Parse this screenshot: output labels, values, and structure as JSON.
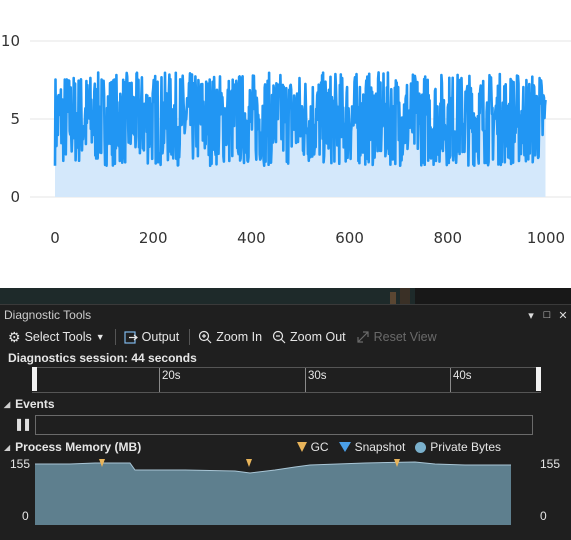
{
  "chart": {
    "y_ticks": [
      "10",
      "5",
      "0"
    ],
    "x_ticks": [
      "0",
      "200",
      "400",
      "600",
      "800",
      "1000"
    ],
    "line_color": "#2196f3",
    "fill_color": "#d4e8fb"
  },
  "chart_data": {
    "type": "area",
    "x_range": [
      0,
      1000
    ],
    "ylim": [
      0,
      10
    ],
    "series": [
      {
        "band_low": 2.0,
        "band_high": 8.0,
        "center": 5.0,
        "points": 1000
      }
    ]
  },
  "diagnostic_tools": {
    "title": "Diagnostic Tools",
    "controls": {
      "dropdown": "▾",
      "maximize": "□",
      "close": "✕"
    },
    "toolbar": {
      "select_tools": "Select Tools",
      "output": "Output",
      "zoom_in": "Zoom In",
      "zoom_out": "Zoom Out",
      "reset_view": "Reset View"
    },
    "session": "Diagnostics session: 44 seconds",
    "ruler_labels": [
      "20s",
      "30s",
      "40s"
    ],
    "events": {
      "label": "Events"
    },
    "process_memory": {
      "label": "Process Memory (MB)",
      "legend": {
        "gc": "GC",
        "snapshot": "Snapshot",
        "private_bytes": "Private Bytes"
      },
      "y_max": "155",
      "y_min": "0",
      "y_max_right": "155",
      "y_min_right": "0",
      "fill_color": "#5e7f8e"
    }
  }
}
